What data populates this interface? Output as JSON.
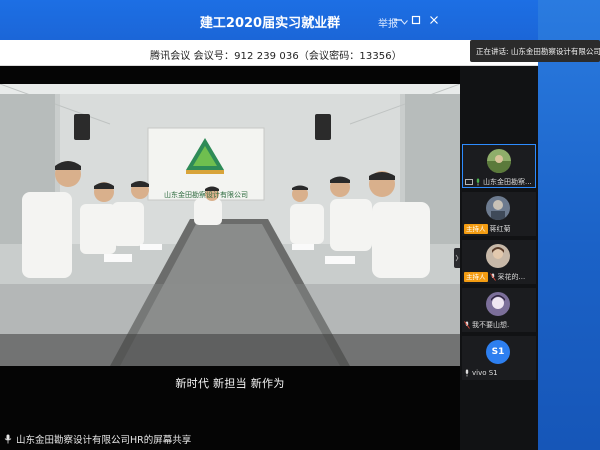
{
  "window": {
    "title": "建工2020届实习就业群",
    "view_label": "举报"
  },
  "infobar": {
    "meeting_info": "腾讯会议  会议号：912 239 036（会议密码：13356）"
  },
  "speaking": {
    "text": "正在讲话: 山东金田勘察设计有限公司HR;"
  },
  "video": {
    "board_text": "山东金田勘察设计有限公司",
    "subtitle": "新时代  新担当  新作为"
  },
  "share": {
    "label": "山东金田勘察设计有限公司HR的屏幕共享"
  },
  "participants": [
    {
      "name": "山东金田勘察...",
      "host": false
    },
    {
      "name": "蒋红菊",
      "host": true,
      "host_label": "主持人"
    },
    {
      "name": "采花的...",
      "host": true,
      "host_label": "主持人"
    },
    {
      "name": "我不要山想.",
      "host": false
    },
    {
      "name": "vivo S1",
      "host": false,
      "initials": "S1"
    }
  ],
  "colors": {
    "titlebar": "#1d6fe4",
    "host_badge": "#f39c12",
    "accent": "#2d7ff0"
  }
}
